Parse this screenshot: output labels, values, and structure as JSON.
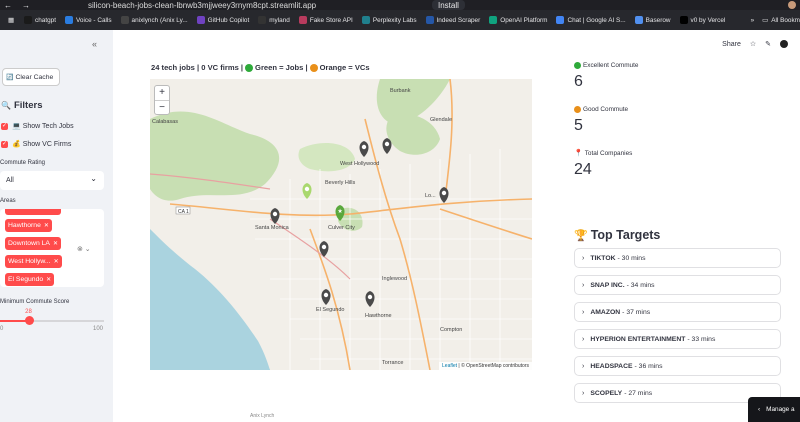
{
  "browser": {
    "url": "silicon-beach-jobs-clean-lbnwb3mjjweey3rnym8cpt.streamlit.app",
    "install_label": "Install",
    "bookmarks": [
      {
        "label": "chatgpt",
        "color": "#1a1a1a"
      },
      {
        "label": "Voice - Calls",
        "color": "#2a7de1"
      },
      {
        "label": "anixlynch (Anix Ly...",
        "color": "#444"
      },
      {
        "label": "GitHub Copilot",
        "color": "#6f42c1"
      },
      {
        "label": "myland",
        "color": "#333"
      },
      {
        "label": "Fake Store API",
        "color": "#b83b5e"
      },
      {
        "label": "Perplexity Labs",
        "color": "#20808d"
      },
      {
        "label": "Indeed Scraper",
        "color": "#2557a7"
      },
      {
        "label": "OpenAI Platform",
        "color": "#10a37f"
      },
      {
        "label": "Chat | Google AI S...",
        "color": "#4285f4"
      },
      {
        "label": "Baserow",
        "color": "#5190ef"
      },
      {
        "label": "v0 by Vercel",
        "color": "#000000"
      }
    ],
    "all_bookmarks": "All Bookm"
  },
  "sidebar": {
    "collapse_icon": "«",
    "clear_cache": "Clear Cache",
    "filters_title": "Filters",
    "show_tech_jobs": "Show Tech Jobs",
    "show_vc_firms": "Show VC Firms",
    "commute_label": "Commute Rating",
    "commute_value": "All",
    "areas_label": "Areas",
    "areas": [
      "Hawthorne",
      "Downtown LA",
      "West Hollyw...",
      "El Segundo"
    ],
    "min_commute_label": "Minimum Commute Score",
    "min_commute_value": "28",
    "min_commute_fraction": 0.28,
    "slider_min": "0",
    "slider_max": "100"
  },
  "toolbar": {
    "share": "Share"
  },
  "map": {
    "caption_prefix": "24 tech jobs | 0 VC firms |",
    "caption_green": "Green = Jobs |",
    "caption_orange": "Orange = VCs",
    "zoom_in": "+",
    "zoom_out": "−",
    "attribution_leaflet": "Leaflet",
    "attribution_rest": "| © OpenStreetMap contributors",
    "labels": {
      "burbank": "Burbank",
      "calabasas": "Calabasas",
      "glendale": "Glendale",
      "west_hollywood": "West Hollywood",
      "beverly_hills": "Beverly Hills",
      "los_angeles": "Lo...",
      "santa_monica": "Santa Monica",
      "culver_city": "Culver City",
      "inglewood": "Inglewood",
      "el_segundo": "El Segundo",
      "hawthorne": "Hawthorne",
      "compton": "Compton",
      "torrance": "Torrance",
      "ca1": "CA 1"
    }
  },
  "metrics": {
    "excellent_label": "Excellent Commute",
    "excellent_value": "6",
    "good_label": "Good Commute",
    "good_value": "5",
    "total_label": "Total Companies",
    "total_value": "24"
  },
  "targets": {
    "title": "Top Targets",
    "items": [
      {
        "name": "TIKTOK",
        "time": "- 30 mins"
      },
      {
        "name": "SNAP INC.",
        "time": "- 34 mins"
      },
      {
        "name": "AMAZON",
        "time": "- 37 mins"
      },
      {
        "name": "HYPERION ENTERTAINMENT",
        "time": "- 33 mins"
      },
      {
        "name": "HEADSPACE",
        "time": "- 36 mins"
      },
      {
        "name": "SCOPELY",
        "time": "- 27 mins"
      }
    ]
  },
  "manage_app": "Manage a",
  "bottom_user": "Anix Lynch",
  "colors": {
    "accent": "#ff4b4b",
    "green": "#2eaa3a",
    "orange": "#e9901a",
    "land": "#f2efe9",
    "water": "#aad3df",
    "park": "#c8dfb3",
    "pin": "#4a4a4a"
  }
}
